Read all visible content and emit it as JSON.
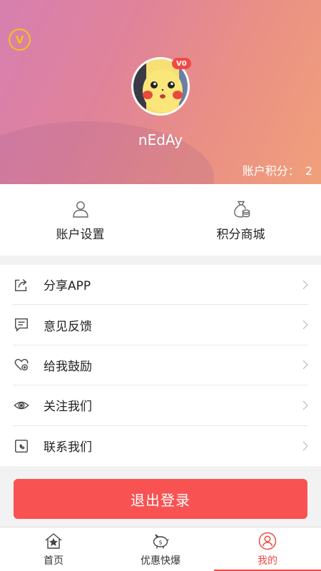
{
  "header": {
    "vip_badge": "V",
    "level_tag": "V0",
    "username": "nEdAy",
    "points_label": "账户积分：",
    "points_value": "2"
  },
  "quick_actions": [
    {
      "label": "账户设置",
      "icon": "user-icon"
    },
    {
      "label": "积分商城",
      "icon": "money-bag-icon"
    }
  ],
  "menu": [
    {
      "label": "分享APP",
      "icon": "share-icon"
    },
    {
      "label": "意见反馈",
      "icon": "feedback-icon"
    },
    {
      "label": "给我鼓励",
      "icon": "heart-icon"
    },
    {
      "label": "关注我们",
      "icon": "eye-icon"
    },
    {
      "label": "联系我们",
      "icon": "contact-icon"
    }
  ],
  "logout_label": "退出登录",
  "tabs": [
    {
      "label": "首页",
      "icon": "home-icon",
      "active": false
    },
    {
      "label": "优惠快爆",
      "icon": "piggy-bank-icon",
      "active": false
    },
    {
      "label": "我的",
      "icon": "profile-icon",
      "active": true
    }
  ],
  "colors": {
    "accent": "#f04a46",
    "logout": "#f85252",
    "vip": "#f2c21a"
  }
}
